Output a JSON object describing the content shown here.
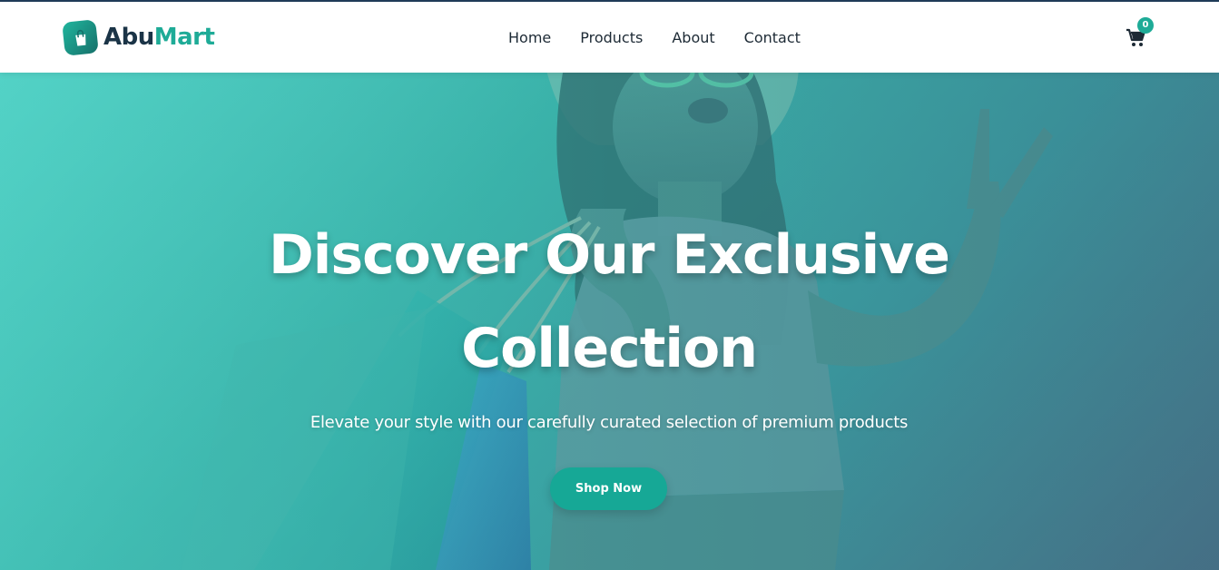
{
  "nav": {
    "brand_part1": "Abu",
    "brand_part2": "Mart",
    "links": [
      {
        "label": "Home"
      },
      {
        "label": "Products"
      },
      {
        "label": "About"
      },
      {
        "label": "Contact"
      }
    ],
    "cart_count": "0",
    "logo_icon": "shopping-bag-icon",
    "cart_icon": "shopping-cart-icon"
  },
  "hero": {
    "title_line1": "Discover Our Exclusive",
    "title_line2": "Collection",
    "subtitle": "Elevate your style with our carefully curated selection of premium products",
    "cta_label": "Shop Now",
    "image_subject": "woman-with-shopping-bags-photo"
  },
  "colors": {
    "brand_dark": "#1b3447",
    "accent": "#1eab97",
    "button": "#16a896",
    "hero_teal": "#54d2c6",
    "hero_slate": "#4a6f86"
  }
}
